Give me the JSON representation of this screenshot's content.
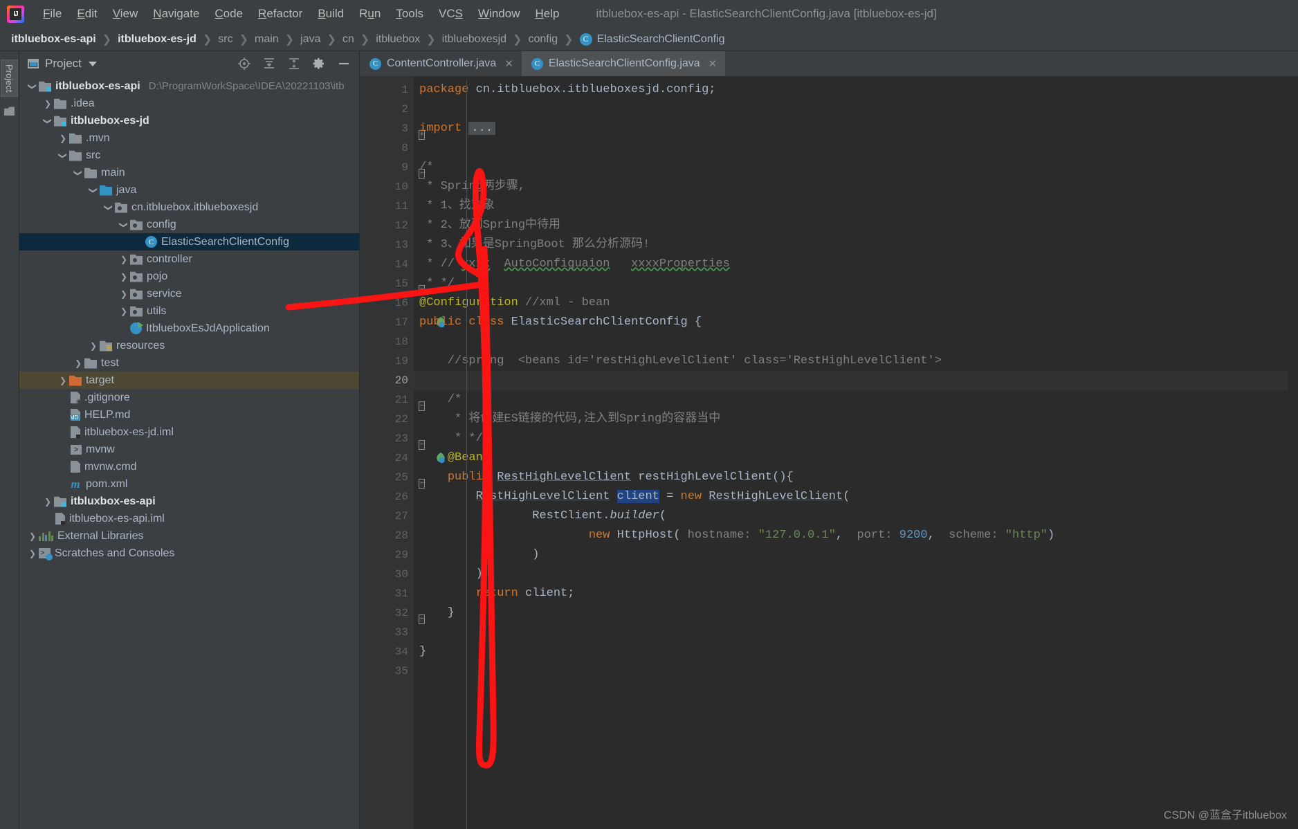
{
  "window": {
    "title": "itbluebox-es-api - ElasticSearchClientConfig.java [itbluebox-es-jd]"
  },
  "menubar": {
    "items": [
      {
        "label": "File",
        "accel": "F"
      },
      {
        "label": "Edit",
        "accel": "E"
      },
      {
        "label": "View",
        "accel": "V"
      },
      {
        "label": "Navigate",
        "accel": "N"
      },
      {
        "label": "Code",
        "accel": "C"
      },
      {
        "label": "Refactor",
        "accel": "R"
      },
      {
        "label": "Build",
        "accel": "B"
      },
      {
        "label": "Run",
        "accel": "u"
      },
      {
        "label": "Tools",
        "accel": "T"
      },
      {
        "label": "VCS",
        "accel": "S"
      },
      {
        "label": "Window",
        "accel": "W"
      },
      {
        "label": "Help",
        "accel": "H"
      }
    ]
  },
  "breadcrumb": {
    "items": [
      "itbluebox-es-api",
      "itbluebox-es-jd",
      "src",
      "main",
      "java",
      "cn",
      "itbluebox",
      "itblueboxesjd",
      "config"
    ],
    "current": "ElasticSearchClientConfig",
    "class_badge": "C"
  },
  "left_strip": {
    "tab_label": "Project"
  },
  "project_panel": {
    "title": "Project",
    "actions": [
      "locate-icon",
      "expand-all-icon",
      "collapse-all-icon",
      "gear-icon",
      "minimize-icon"
    ],
    "tree": [
      {
        "depth": 0,
        "arrow": "down",
        "icon": "module",
        "label": "itbluebox-es-api",
        "bold": true,
        "path": "D:\\ProgramWorkSpace\\IDEA\\20221103\\itb"
      },
      {
        "depth": 1,
        "arrow": "right",
        "icon": "folder",
        "label": ".idea"
      },
      {
        "depth": 1,
        "arrow": "down",
        "icon": "module",
        "label": "itbluebox-es-jd",
        "bold": true
      },
      {
        "depth": 2,
        "arrow": "right",
        "icon": "folder",
        "label": ".mvn"
      },
      {
        "depth": 2,
        "arrow": "down",
        "icon": "folder",
        "label": "src"
      },
      {
        "depth": 3,
        "arrow": "down",
        "icon": "folder",
        "label": "main"
      },
      {
        "depth": 4,
        "arrow": "down",
        "icon": "folder-blue",
        "label": "java"
      },
      {
        "depth": 5,
        "arrow": "down",
        "icon": "package",
        "label": "cn.itbluebox.itblueboxesjd"
      },
      {
        "depth": 6,
        "arrow": "down",
        "icon": "package",
        "label": "config"
      },
      {
        "depth": 7,
        "arrow": "none",
        "icon": "class",
        "label": "ElasticSearchClientConfig",
        "selected": true
      },
      {
        "depth": 6,
        "arrow": "right",
        "icon": "package",
        "label": "controller"
      },
      {
        "depth": 6,
        "arrow": "right",
        "icon": "package",
        "label": "pojo"
      },
      {
        "depth": 6,
        "arrow": "right",
        "icon": "package",
        "label": "service"
      },
      {
        "depth": 6,
        "arrow": "right",
        "icon": "package",
        "label": "utils"
      },
      {
        "depth": 6,
        "arrow": "none",
        "icon": "springboot",
        "label": "ItblueboxEsJdApplication"
      },
      {
        "depth": 4,
        "arrow": "right",
        "icon": "resources",
        "label": "resources"
      },
      {
        "depth": 3,
        "arrow": "right",
        "icon": "folder",
        "label": "test"
      },
      {
        "depth": 2,
        "arrow": "right",
        "icon": "target",
        "label": "target",
        "highlight": true
      },
      {
        "depth": 2,
        "arrow": "none",
        "icon": "gitignore",
        "label": ".gitignore"
      },
      {
        "depth": 2,
        "arrow": "none",
        "icon": "md",
        "label": "HELP.md"
      },
      {
        "depth": 2,
        "arrow": "none",
        "icon": "iml",
        "label": "itbluebox-es-jd.iml"
      },
      {
        "depth": 2,
        "arrow": "none",
        "icon": "shell",
        "label": "mvnw"
      },
      {
        "depth": 2,
        "arrow": "none",
        "icon": "cmd",
        "label": "mvnw.cmd"
      },
      {
        "depth": 2,
        "arrow": "none",
        "icon": "maven",
        "label": "pom.xml"
      },
      {
        "depth": 1,
        "arrow": "right",
        "icon": "module",
        "label": "itbluxbox-es-api",
        "bold": true
      },
      {
        "depth": 1,
        "arrow": "none",
        "icon": "iml",
        "label": "itbluebox-es-api.iml"
      },
      {
        "depth": 0,
        "arrow": "right",
        "icon": "libraries",
        "label": "External Libraries"
      },
      {
        "depth": 0,
        "arrow": "right",
        "icon": "scratches",
        "label": "Scratches and Consoles"
      }
    ]
  },
  "editor": {
    "tabs": [
      {
        "label": "ContentController.java",
        "active": false,
        "badge": "C",
        "closable": true
      },
      {
        "label": "ElasticSearchClientConfig.java",
        "active": true,
        "badge": "C",
        "closable": true
      }
    ],
    "line_numbers": [
      1,
      2,
      3,
      8,
      9,
      10,
      11,
      12,
      13,
      14,
      15,
      16,
      17,
      18,
      19,
      20,
      21,
      22,
      23,
      24,
      25,
      26,
      27,
      28,
      29,
      30,
      31,
      32,
      33,
      34,
      35
    ],
    "current_line": 20,
    "gutter_marks": {
      "17": "spring-bean-icon",
      "24": "spring-bean-icon"
    },
    "folds": {
      "3": "plus",
      "9": "minus",
      "15": "minus-end",
      "21": "minus",
      "23": "minus-end",
      "25": "minus",
      "32": "minus-end"
    },
    "lines": [
      {
        "n": 1,
        "tokens": [
          {
            "t": "package ",
            "c": "k"
          },
          {
            "t": "cn.itbluebox.itblueboxesjd.config;",
            "c": ""
          }
        ]
      },
      {
        "n": 2,
        "tokens": []
      },
      {
        "n": 3,
        "tokens": [
          {
            "t": "import ",
            "c": "k"
          },
          {
            "t": "...",
            "c": "fold"
          }
        ]
      },
      {
        "n": 8,
        "tokens": []
      },
      {
        "n": 9,
        "tokens": [
          {
            "t": "/*",
            "c": "cm"
          }
        ]
      },
      {
        "n": 10,
        "tokens": [
          {
            "t": " * Spring两步骤,",
            "c": "cm"
          }
        ]
      },
      {
        "n": 11,
        "tokens": [
          {
            "t": " * 1、找对象",
            "c": "cm"
          }
        ]
      },
      {
        "n": 12,
        "tokens": [
          {
            "t": " * 2、放到Spring中待用",
            "c": "cm"
          }
        ]
      },
      {
        "n": 13,
        "tokens": [
          {
            "t": " * 3、如果是SpringBoot 那么分析源码!",
            "c": "cm"
          }
        ]
      },
      {
        "n": 14,
        "tokens": [
          {
            "t": " * // ",
            "c": "cm"
          },
          {
            "t": "xxxx",
            "c": "cm sq"
          },
          {
            "t": "  ",
            "c": "cm"
          },
          {
            "t": "AutoConfiguaion",
            "c": "cm sq"
          },
          {
            "t": "   ",
            "c": "cm"
          },
          {
            "t": "xxxxProperties",
            "c": "cm sq"
          }
        ]
      },
      {
        "n": 15,
        "tokens": [
          {
            "t": " * */",
            "c": "cm"
          }
        ]
      },
      {
        "n": 16,
        "tokens": [
          {
            "t": "@Configuration",
            "c": "an"
          },
          {
            "t": " ",
            "c": ""
          },
          {
            "t": "//xml - bean",
            "c": "cm"
          }
        ]
      },
      {
        "n": 17,
        "tokens": [
          {
            "t": "public ",
            "c": "k"
          },
          {
            "t": "class ",
            "c": "k"
          },
          {
            "t": "ElasticSearchClientConfig",
            "c": ""
          },
          {
            "t": " {",
            "c": ""
          }
        ]
      },
      {
        "n": 18,
        "tokens": []
      },
      {
        "n": 19,
        "tokens": [
          {
            "t": "    //spring  <beans id='restHighLevelClient' class='RestHighLevelClient'>",
            "c": "cm"
          }
        ]
      },
      {
        "n": 20,
        "tokens": []
      },
      {
        "n": 21,
        "tokens": [
          {
            "t": "    /*",
            "c": "cm"
          }
        ]
      },
      {
        "n": 22,
        "tokens": [
          {
            "t": "     * 将创建ES链接的代码,注入到Spring的容器当中",
            "c": "cm"
          }
        ]
      },
      {
        "n": 23,
        "tokens": [
          {
            "t": "     * */",
            "c": "cm"
          }
        ]
      },
      {
        "n": 24,
        "tokens": [
          {
            "t": "    @Bean",
            "c": "an"
          }
        ]
      },
      {
        "n": 25,
        "tokens": [
          {
            "t": "    ",
            "c": ""
          },
          {
            "t": "public ",
            "c": "k"
          },
          {
            "t": "RestHighLevelClient",
            "c": "ty"
          },
          {
            "t": " restHighLevelClient(){",
            "c": ""
          }
        ]
      },
      {
        "n": 26,
        "tokens": [
          {
            "t": "        ",
            "c": ""
          },
          {
            "t": "RestHighLevelClient",
            "c": "ty"
          },
          {
            "t": " ",
            "c": ""
          },
          {
            "t": "client",
            "c": "sel-tok"
          },
          {
            "t": " = ",
            "c": ""
          },
          {
            "t": "new ",
            "c": "k"
          },
          {
            "t": "RestHighLevelClient",
            "c": "ty"
          },
          {
            "t": "(",
            "c": ""
          }
        ]
      },
      {
        "n": 27,
        "tokens": [
          {
            "t": "                RestClient.",
            "c": ""
          },
          {
            "t": "builder",
            "c": "it"
          },
          {
            "t": "(",
            "c": ""
          }
        ]
      },
      {
        "n": 28,
        "tokens": [
          {
            "t": "                        ",
            "c": ""
          },
          {
            "t": "new ",
            "c": "k"
          },
          {
            "t": "HttpHost(",
            "c": ""
          },
          {
            "t": " hostname: ",
            "c": "hint"
          },
          {
            "t": "\"127.0.0.1\"",
            "c": "st"
          },
          {
            "t": ", ",
            "c": ""
          },
          {
            "t": " port: ",
            "c": "hint"
          },
          {
            "t": "9200",
            "c": "nm"
          },
          {
            "t": ", ",
            "c": ""
          },
          {
            "t": " scheme: ",
            "c": "hint"
          },
          {
            "t": "\"http\"",
            "c": "st"
          },
          {
            "t": ")",
            "c": ""
          }
        ]
      },
      {
        "n": 29,
        "tokens": [
          {
            "t": "                )",
            "c": ""
          }
        ]
      },
      {
        "n": 30,
        "tokens": [
          {
            "t": "        );",
            "c": ""
          }
        ]
      },
      {
        "n": 31,
        "tokens": [
          {
            "t": "        ",
            "c": ""
          },
          {
            "t": "return ",
            "c": "k"
          },
          {
            "t": "client;",
            "c": ""
          }
        ]
      },
      {
        "n": 32,
        "tokens": [
          {
            "t": "    }",
            "c": ""
          }
        ]
      },
      {
        "n": 33,
        "tokens": []
      },
      {
        "n": 34,
        "tokens": [
          {
            "t": "}",
            "c": ""
          }
        ]
      },
      {
        "n": 35,
        "tokens": []
      }
    ]
  },
  "watermark": "CSDN @蓝盒子itbluebox",
  "colors": {
    "accent": "#3592c4",
    "annotation": "#fb1414",
    "editor_bg": "#2b2b2b",
    "panel_bg": "#3c3f41",
    "selection": "#0d293e",
    "target_highlight": "#4e4833"
  }
}
